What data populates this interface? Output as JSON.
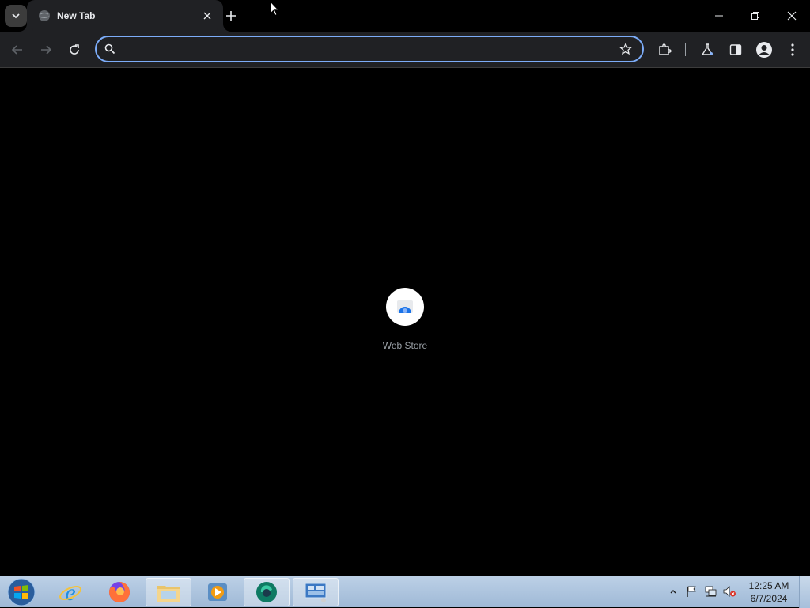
{
  "browser": {
    "tab": {
      "title": "New Tab"
    },
    "omnibox": {
      "value": "",
      "placeholder": ""
    },
    "accent": "#7cacf8"
  },
  "new_tab_page": {
    "shortcuts": [
      {
        "label": "Web Store"
      }
    ]
  },
  "taskbar": {
    "apps": [
      "start-orb-icon",
      "internet-explorer-icon",
      "firefox-icon",
      "file-explorer-icon",
      "media-player-icon",
      "browser-app-icon",
      "control-panel-icon"
    ],
    "clock": {
      "time": "12:25 AM",
      "date": "6/7/2024"
    }
  }
}
